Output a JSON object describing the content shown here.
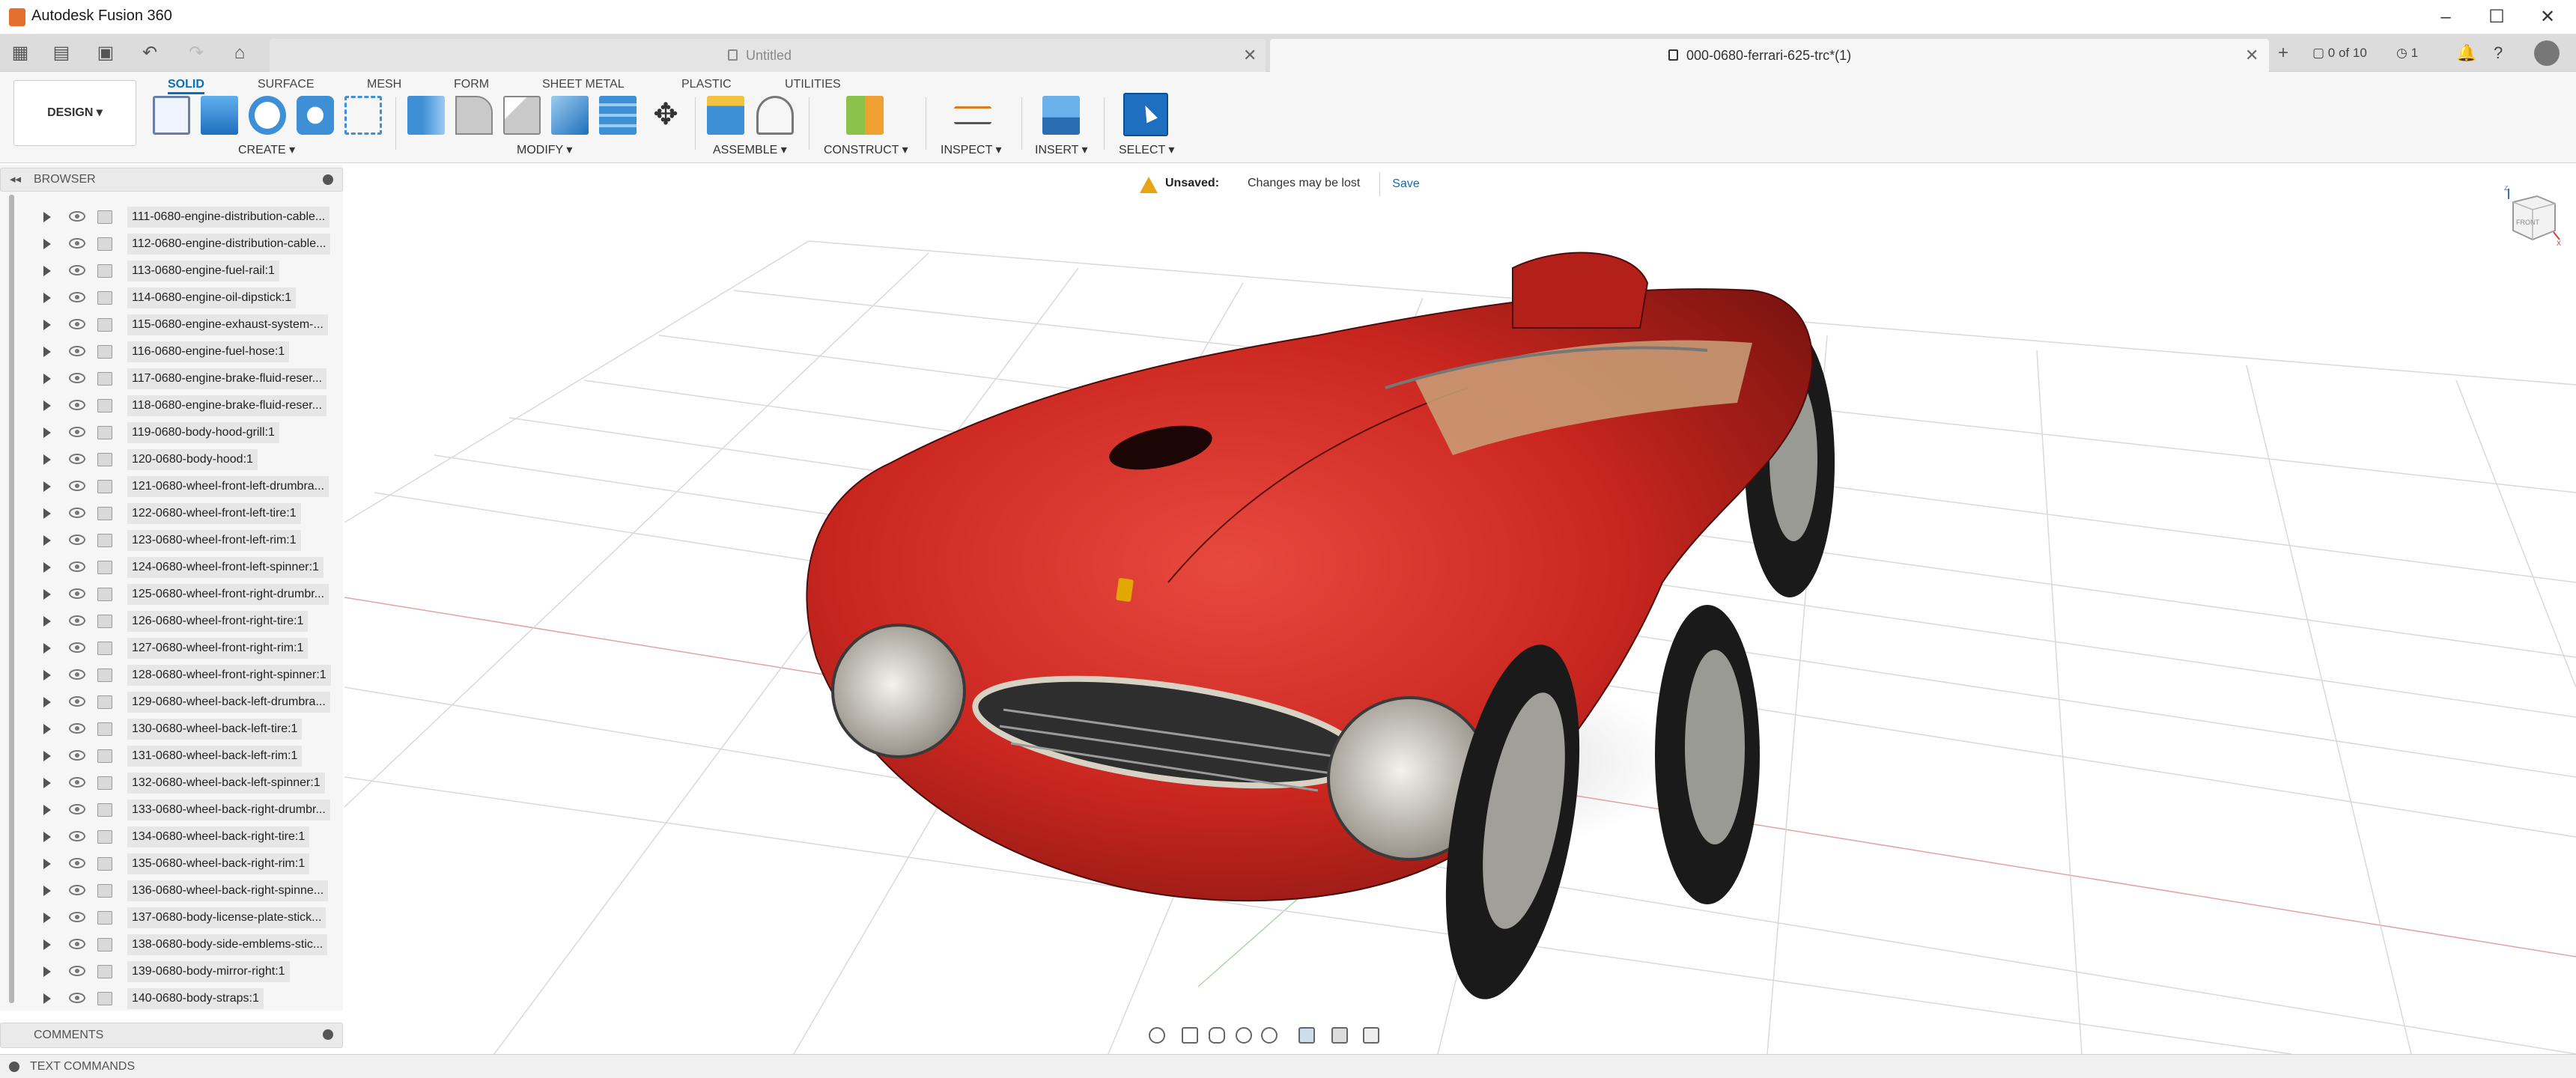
{
  "window": {
    "title": "Autodesk Fusion 360",
    "controls": {
      "minimize": "–",
      "maximize": "☐",
      "close": "✕"
    }
  },
  "tabs": {
    "items": [
      {
        "label": "Untitled",
        "active": false
      },
      {
        "label": "000-0680-ferrari-625-trc*(1)",
        "active": true
      }
    ],
    "close_glyph": "✕",
    "job_status": "0 of 10",
    "history_count": "1"
  },
  "ribbon": {
    "workspace": "DESIGN ▾",
    "tabs": [
      "SOLID",
      "SURFACE",
      "MESH",
      "FORM",
      "SHEET METAL",
      "PLASTIC",
      "UTILITIES"
    ],
    "groups": [
      "CREATE ▾",
      "MODIFY ▾",
      "ASSEMBLE ▾",
      "CONSTRUCT ▾",
      "INSPECT ▾",
      "INSERT ▾",
      "SELECT ▾"
    ]
  },
  "browser": {
    "title": "BROWSER",
    "items": [
      "111-0680-engine-distribution-cable...",
      "112-0680-engine-distribution-cable...",
      "113-0680-engine-fuel-rail:1",
      "114-0680-engine-oil-dipstick:1",
      "115-0680-engine-exhaust-system-...",
      "116-0680-engine-fuel-hose:1",
      "117-0680-engine-brake-fluid-reser...",
      "118-0680-engine-brake-fluid-reser...",
      "119-0680-body-hood-grill:1",
      "120-0680-body-hood:1",
      "121-0680-wheel-front-left-drumbra...",
      "122-0680-wheel-front-left-tire:1",
      "123-0680-wheel-front-left-rim:1",
      "124-0680-wheel-front-left-spinner:1",
      "125-0680-wheel-front-right-drumbr...",
      "126-0680-wheel-front-right-tire:1",
      "127-0680-wheel-front-right-rim:1",
      "128-0680-wheel-front-right-spinner:1",
      "129-0680-wheel-back-left-drumbra...",
      "130-0680-wheel-back-left-tire:1",
      "131-0680-wheel-back-left-rim:1",
      "132-0680-wheel-back-left-spinner:1",
      "133-0680-wheel-back-right-drumbr...",
      "134-0680-wheel-back-right-tire:1",
      "135-0680-wheel-back-right-rim:1",
      "136-0680-wheel-back-right-spinne...",
      "137-0680-body-license-plate-stick...",
      "138-0680-body-side-emblems-stic...",
      "139-0680-body-mirror-right:1",
      "140-0680-body-straps:1"
    ]
  },
  "notice": {
    "label": "Unsaved:",
    "message": "Changes may be lost",
    "save": "Save"
  },
  "viewcube": {
    "face": "FRONT",
    "axis_x": "X",
    "axis_z": "Z"
  },
  "panels": {
    "comments": "COMMENTS",
    "text_commands": "TEXT COMMANDS"
  },
  "colors": {
    "accent": "#0b6fb7",
    "car_body": "#c9261f",
    "warning": "#e8a317"
  }
}
